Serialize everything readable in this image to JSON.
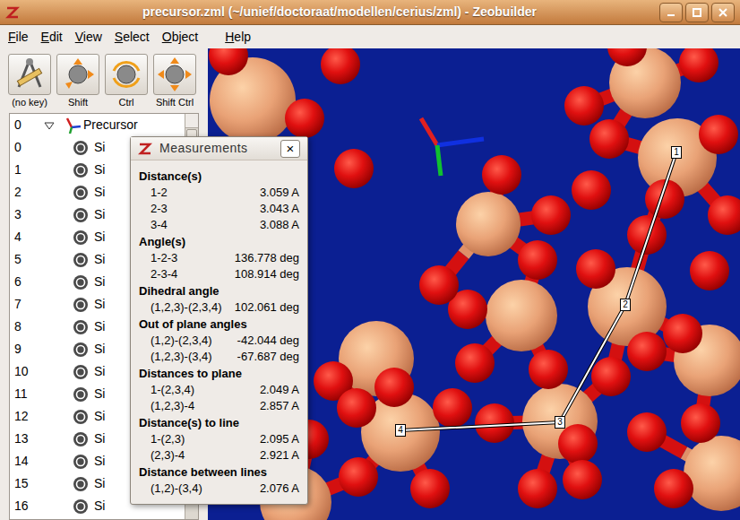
{
  "window": {
    "title": "precursor.zml (~/unief/doctoraat/modellen/cerius/zml) - Zeobuilder"
  },
  "menu": [
    "File",
    "Edit",
    "View",
    "Select",
    "Object",
    "Help"
  ],
  "toolbar": [
    {
      "label": "(no key)"
    },
    {
      "label": "Shift"
    },
    {
      "label": "Ctrl"
    },
    {
      "label": "Shift Ctrl"
    }
  ],
  "tree": {
    "root": {
      "index": "0",
      "label": "Precursor",
      "expanded": true
    },
    "items": [
      {
        "index": "0",
        "label": "Si"
      },
      {
        "index": "1",
        "label": "Si"
      },
      {
        "index": "2",
        "label": "Si"
      },
      {
        "index": "3",
        "label": "Si"
      },
      {
        "index": "4",
        "label": "Si"
      },
      {
        "index": "5",
        "label": "Si"
      },
      {
        "index": "6",
        "label": "Si"
      },
      {
        "index": "7",
        "label": "Si"
      },
      {
        "index": "8",
        "label": "Si"
      },
      {
        "index": "9",
        "label": "Si"
      },
      {
        "index": "10",
        "label": "Si"
      },
      {
        "index": "11",
        "label": "Si"
      },
      {
        "index": "12",
        "label": "Si"
      },
      {
        "index": "13",
        "label": "Si"
      },
      {
        "index": "14",
        "label": "Si"
      },
      {
        "index": "15",
        "label": "Si"
      },
      {
        "index": "16",
        "label": "Si"
      }
    ]
  },
  "viewport": {
    "points": [
      "1",
      "2",
      "3",
      "4"
    ]
  },
  "measurements": {
    "title": "Measurements",
    "close": "×",
    "sections": [
      {
        "title": "Distance(s)",
        "rows": [
          [
            "1-2",
            "3.059 A"
          ],
          [
            "2-3",
            "3.043 A"
          ],
          [
            "3-4",
            "3.088 A"
          ]
        ]
      },
      {
        "title": "Angle(s)",
        "rows": [
          [
            "1-2-3",
            "136.778 deg"
          ],
          [
            "2-3-4",
            "108.914 deg"
          ]
        ]
      },
      {
        "title": "Dihedral angle",
        "rows": [
          [
            "(1,2,3)-(2,3,4)",
            "102.061 deg"
          ]
        ]
      },
      {
        "title": "Out of plane angles",
        "rows": [
          [
            "(1,2)-(2,3,4)",
            "-42.044 deg"
          ],
          [
            "(1,2,3)-(3,4)",
            "-67.687 deg"
          ]
        ]
      },
      {
        "title": "Distances to plane",
        "rows": [
          [
            "1-(2,3,4)",
            "2.049 A"
          ],
          [
            "(1,2,3)-4",
            "2.857 A"
          ]
        ]
      },
      {
        "title": "Distance(s) to line",
        "rows": [
          [
            "1-(2,3)",
            "2.095 A"
          ],
          [
            "(2,3)-4",
            "2.921 A"
          ]
        ]
      },
      {
        "title": "Distance between lines",
        "rows": [
          [
            "(1,2)-(3,4)",
            "2.076 A"
          ]
        ]
      }
    ]
  }
}
